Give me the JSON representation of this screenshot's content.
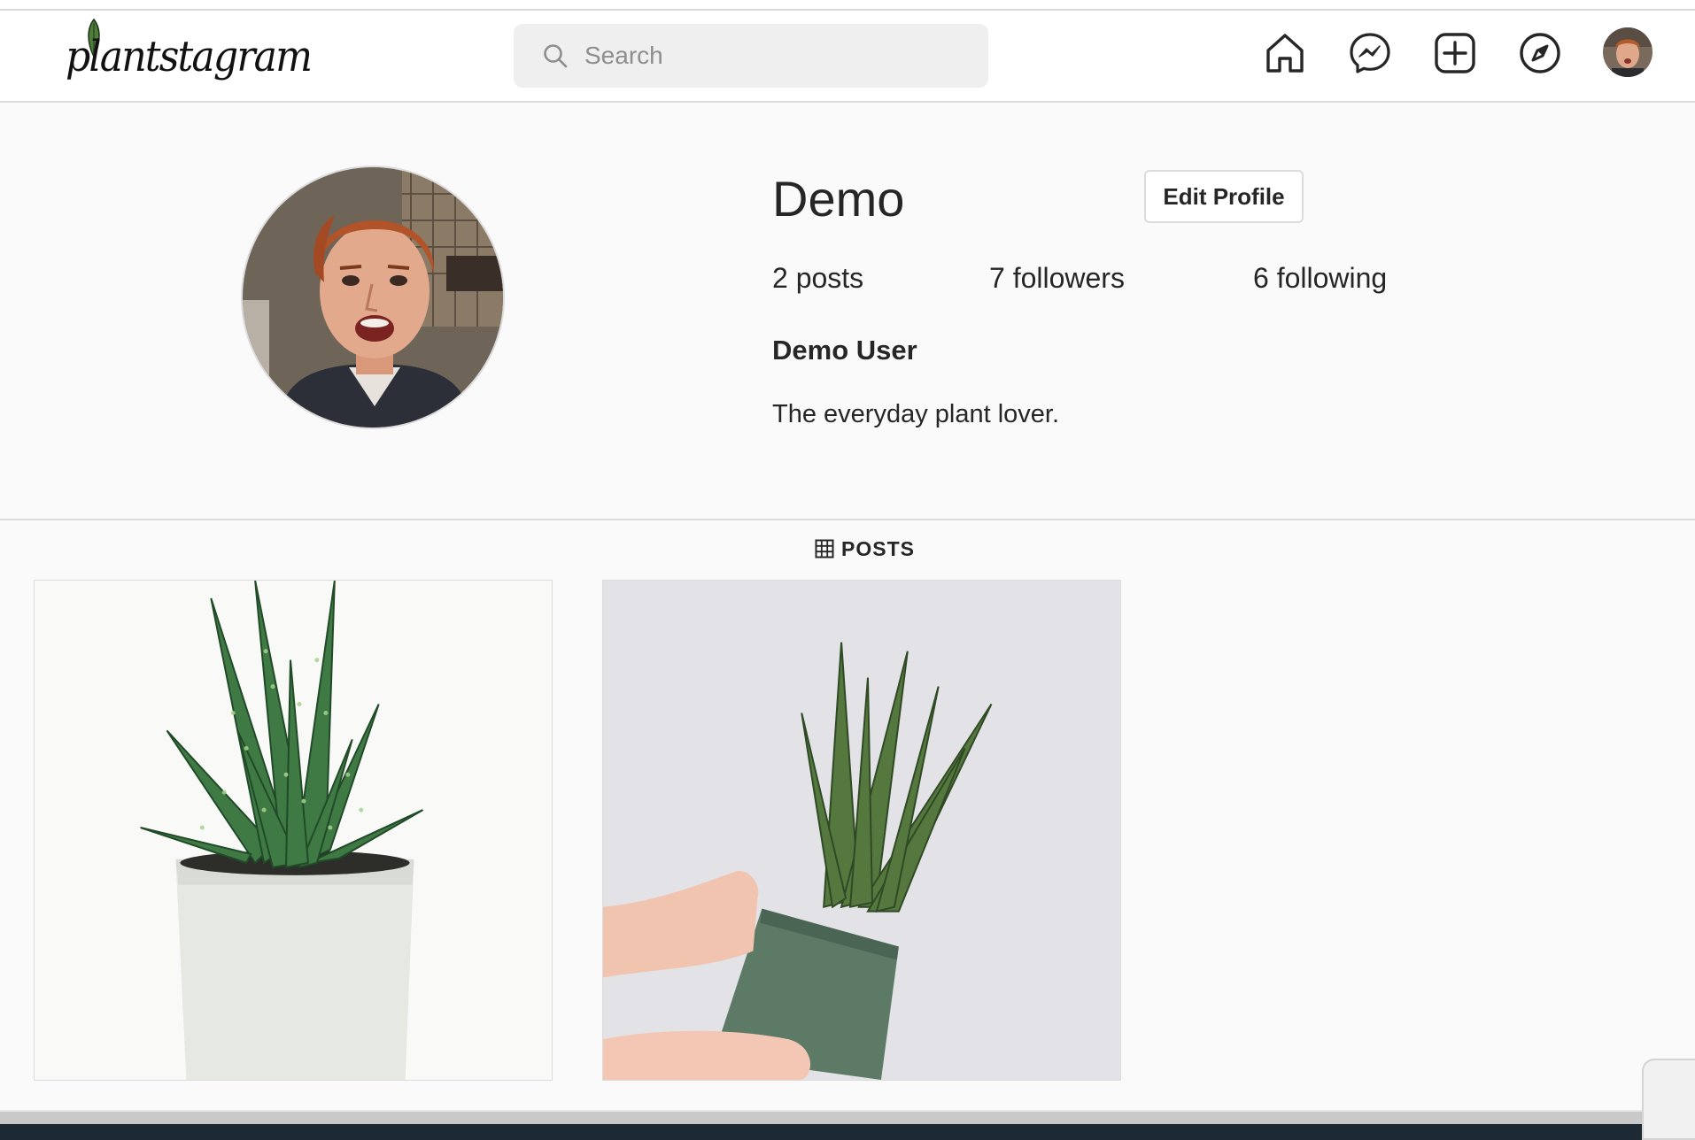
{
  "app": {
    "logo_text": "plantstagram"
  },
  "navbar": {
    "search_placeholder": "Search",
    "icons": [
      "home-icon",
      "messenger-icon",
      "new-post-icon",
      "explore-icon",
      "avatar"
    ]
  },
  "profile": {
    "username": "Demo",
    "edit_button_label": "Edit Profile",
    "stats": {
      "posts": "2 posts",
      "followers": "7 followers",
      "following": "6 following"
    },
    "full_name": "Demo User",
    "bio": "The everyday plant lover."
  },
  "tabs": {
    "posts_label": "POSTS"
  },
  "posts": [
    {
      "subject": "aloe plant in white concrete pot"
    },
    {
      "subject": "snake plant in green pot held by hands"
    }
  ],
  "colors": {
    "background": "#fafafa",
    "border": "#dbdbdb",
    "text": "#262626",
    "search_bg": "#efefef"
  }
}
